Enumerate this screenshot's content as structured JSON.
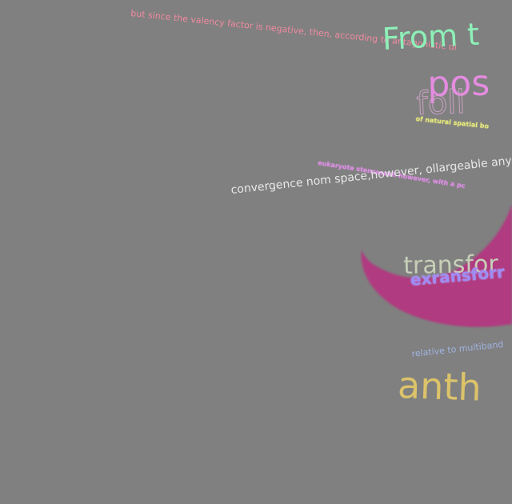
{
  "texts": {
    "t1": "but since the valency factor is negative, then, according to antagonistic di",
    "t2": "From t",
    "t3": "pos",
    "t4": "foll",
    "t5": "of natural spatial bo",
    "t6": "eukaryote stenzesuch however, with a pc",
    "t7": "convergence nom space,however, ollargeable any pc",
    "t8": "transfor",
    "t9": "exransforr",
    "t10": "relative to multiband",
    "t11": "anth"
  },
  "colors": {
    "background": "#808080",
    "shape_fill": "#b03a80"
  }
}
